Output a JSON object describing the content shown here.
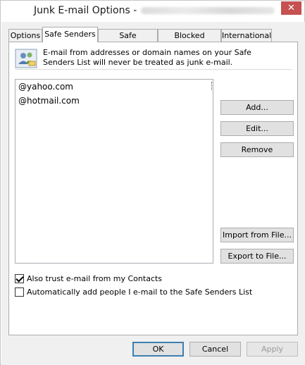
{
  "window": {
    "title": "Junk E-mail Options -",
    "close_glyph": "✕"
  },
  "tabs": [
    {
      "label": "Options",
      "active": false
    },
    {
      "label": "Safe Senders",
      "active": true
    },
    {
      "label": "Safe Recipients",
      "active": false
    },
    {
      "label": "Blocked Senders",
      "active": false
    },
    {
      "label": "International",
      "active": false
    }
  ],
  "safe_senders": {
    "icon": "contacts-icon",
    "description": "E-mail from addresses or domain names on your Safe Senders List will never be treated as junk e-mail.",
    "entries": [
      "@yahoo.com",
      "@hotmail.com"
    ],
    "buttons": {
      "add": "Add...",
      "edit": "Edit...",
      "remove": "Remove",
      "import": "Import from File...",
      "export": "Export to File..."
    },
    "checkboxes": [
      {
        "label": "Also trust e-mail from my Contacts",
        "checked": true
      },
      {
        "label": "Automatically add people I e-mail to the Safe Senders List",
        "checked": false
      }
    ]
  },
  "footer": {
    "ok": "OK",
    "cancel": "Cancel",
    "apply": "Apply"
  }
}
